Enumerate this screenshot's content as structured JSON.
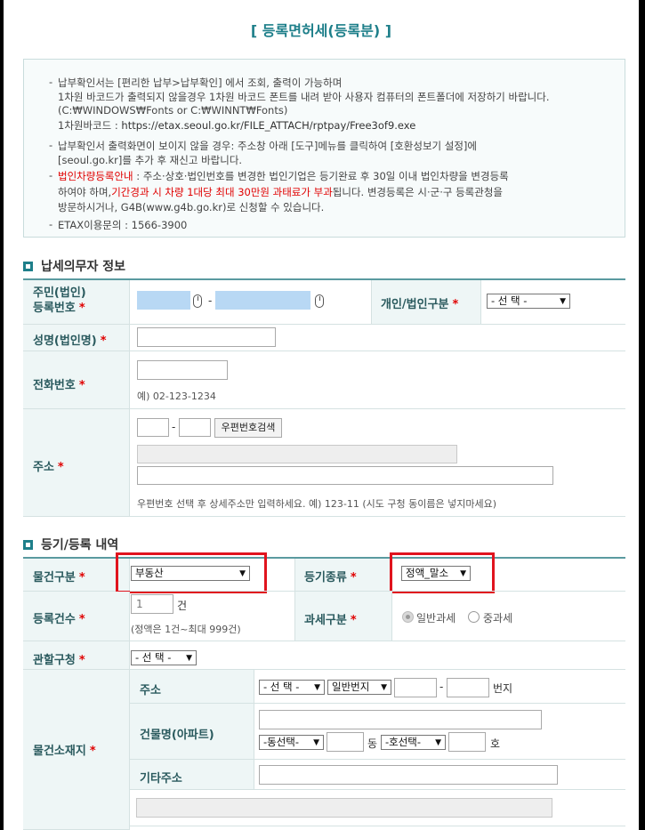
{
  "page": {
    "title": "[ 등록면허세(등록분) ]"
  },
  "notice": {
    "line1": "납부확인서는 [편리한 납부>납부확인] 에서 조회, 출력이 가능하며",
    "line2": "1차원 바코드가 출력되지 않을경우 1차원 바코드 폰트를 내려 받아 사용자 컴퓨터의 폰트폴더에 저장하기 바랍니다.",
    "line3": "(C:₩WINDOWS₩Fonts or C:₩WINNT₩Fonts)",
    "line4_prefix": "1차원바코드 : ",
    "line4_link": "https://etax.seoul.go.kr/FILE_ATTACH/rptpay/Free3of9.exe",
    "line5": "납부확인서 출력화면이 보이지 않을 경우: 주소창 아래 [도구]메뉴를 클릭하여 [호환성보기 설정]에",
    "line6": "[seoul.go.kr]를 추가 후 재신고 바랍니다.",
    "line7_red": "법인차량등록안내",
    "line7_rest": " : 주소·상호·법인번호를 변경한 법인기업은 등기완료 후 30일 이내 법인차량을 변경등록",
    "line8_prefix": "하여야 하며,",
    "line8_red": "기간경과 시 차량 1대당 최대 30만원 과태료가 부과",
    "line8_suffix": "됩니다. 변경등록은 시·군·구 등록관청을",
    "line9": "방문하시거나, G4B(www.g4b.go.kr)로 신청할 수 있습니다.",
    "line10": "ETAX이용문의 : 1566-3900"
  },
  "taxpayer": {
    "section_title": "납세의무자 정보",
    "id_label_1": "주민(법인)",
    "id_label_2": "등록번호",
    "id_separator": "-",
    "type_label": "개인/법인구분",
    "type_value": "- 선 택 -",
    "name_label": "성명(법인명)",
    "phone_label": "전화번호",
    "phone_hint": "예) 02-123-1234",
    "address_label": "주소",
    "zip_separator": "-",
    "zip_search_button": "우편번호검색",
    "address_hint": "우편번호 선택 후 상세주소만 입력하세요. 예) 123-11 (시도 구청 동이름은 넣지마세요)"
  },
  "registration": {
    "section_title": "등기/등록 내역",
    "item_type_label": "물건구분",
    "item_type_value": "부동산",
    "reg_type_label": "등기종류",
    "reg_type_value": "정액_말소",
    "count_label": "등록건수",
    "count_value": "1",
    "count_unit": "건",
    "count_hint": "(정액은 1건~최대 999건)",
    "tax_type_label": "과세구분",
    "tax_type_options": [
      "일반과세",
      "중과세"
    ],
    "office_label": "관할구청",
    "office_value": "- 선 택 -",
    "location_label": "물건소재지",
    "loc_address_label": "주소",
    "loc_select1": "- 선 택 -",
    "loc_select2": "일반번지",
    "loc_separator": "-",
    "loc_unit": "번지",
    "building_label": "건물명(아파트)",
    "dong_select": "-동선택-",
    "dong_unit": "동",
    "ho_select": "-호선택-",
    "ho_unit": "호",
    "other_label": "기타주소"
  },
  "colors": {
    "accent": "#1e7f8a",
    "required_star": "#e00000",
    "highlight_box": "#e0141e"
  }
}
